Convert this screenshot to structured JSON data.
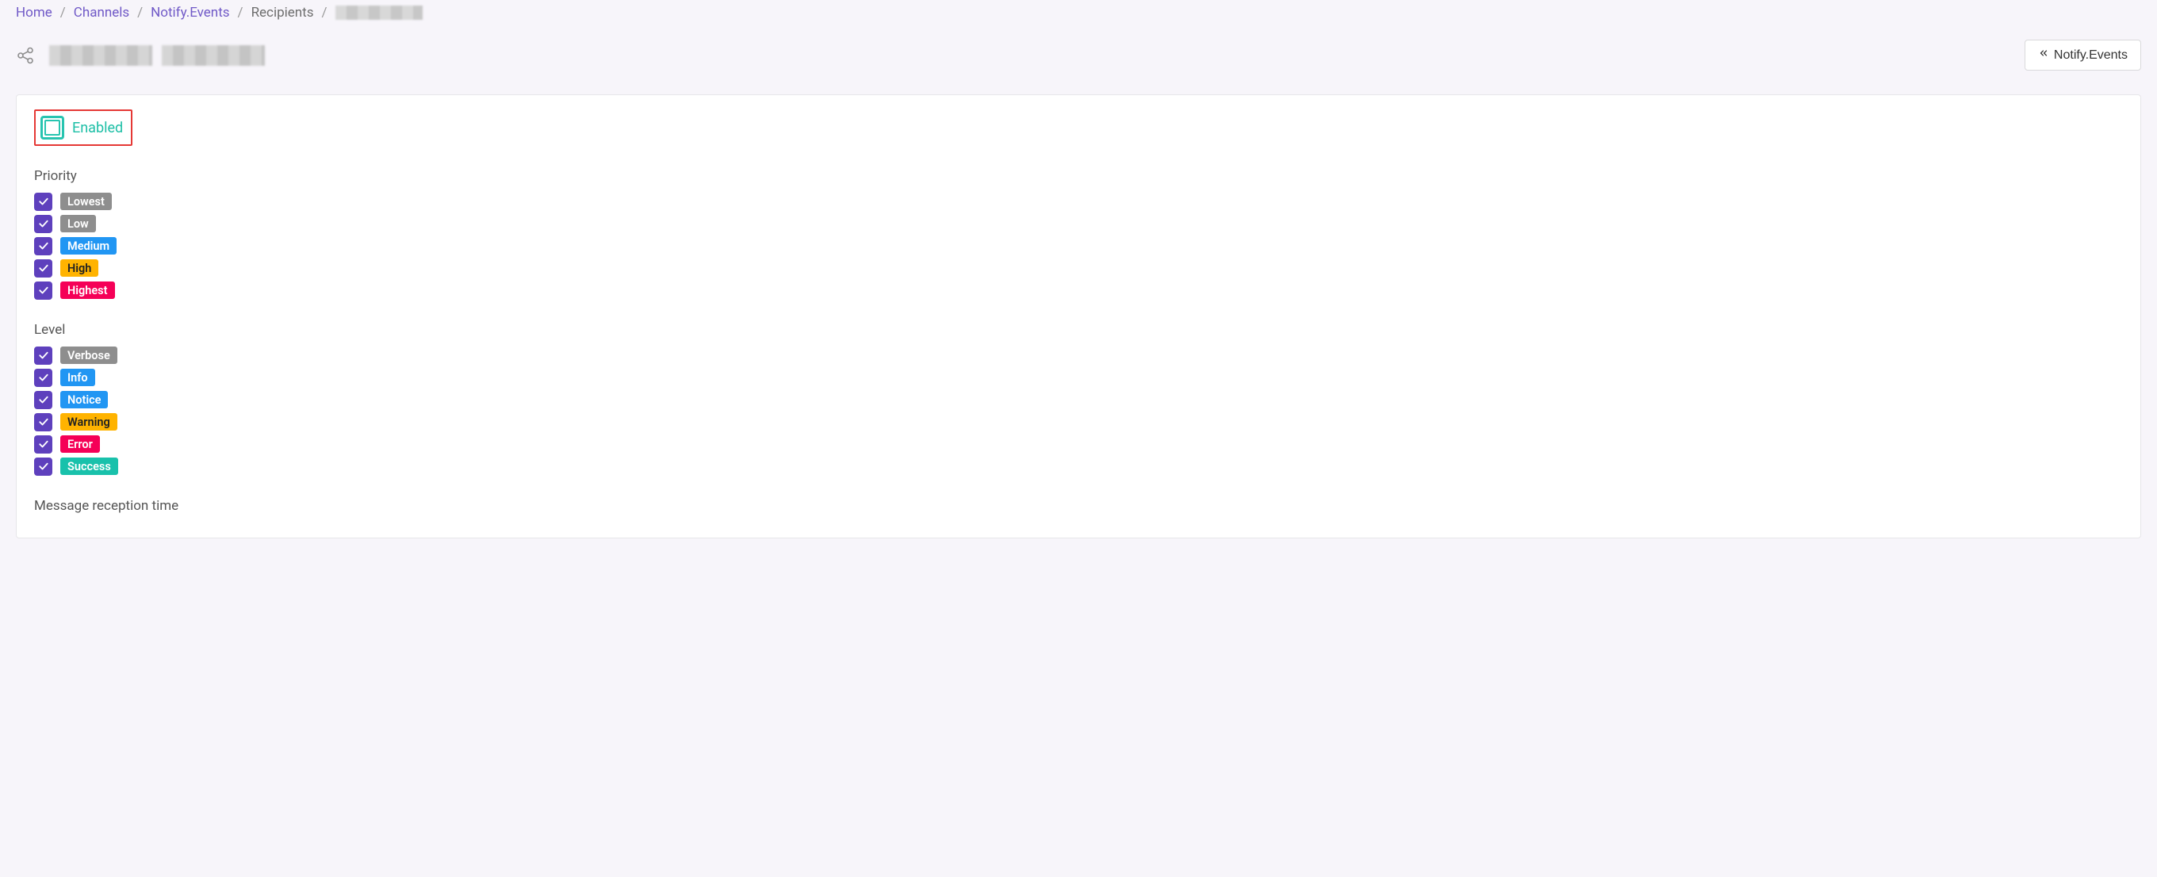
{
  "breadcrumb": {
    "home": "Home",
    "channels": "Channels",
    "notify_events": "Notify.Events",
    "recipients": "Recipients"
  },
  "header": {
    "back_button": "Notify.Events"
  },
  "card": {
    "enabled_label": "Enabled",
    "priority": {
      "title": "Priority",
      "items": [
        {
          "label": "Lowest",
          "color": "gray",
          "text": "light"
        },
        {
          "label": "Low",
          "color": "gray",
          "text": "light"
        },
        {
          "label": "Medium",
          "color": "blue",
          "text": "light"
        },
        {
          "label": "High",
          "color": "amber",
          "text": "dark"
        },
        {
          "label": "Highest",
          "color": "pink",
          "text": "light"
        }
      ]
    },
    "level": {
      "title": "Level",
      "items": [
        {
          "label": "Verbose",
          "color": "gray",
          "text": "light"
        },
        {
          "label": "Info",
          "color": "blue",
          "text": "light"
        },
        {
          "label": "Notice",
          "color": "blue",
          "text": "light"
        },
        {
          "label": "Warning",
          "color": "amber",
          "text": "dark"
        },
        {
          "label": "Error",
          "color": "pink",
          "text": "light"
        },
        {
          "label": "Success",
          "color": "teal",
          "text": "light"
        }
      ]
    },
    "message_reception_title": "Message reception time"
  }
}
